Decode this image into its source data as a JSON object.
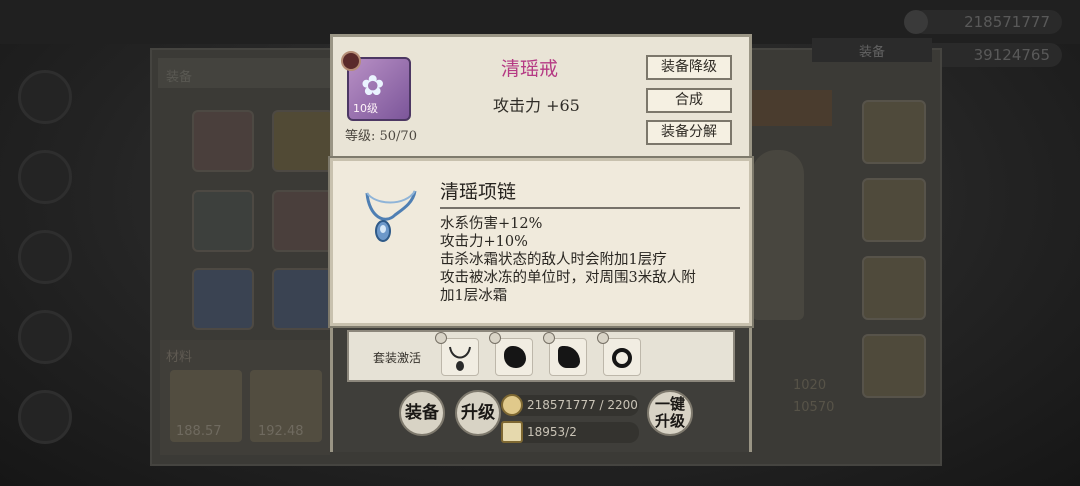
{
  "background": {
    "currencies": [
      "218571777",
      "39124765"
    ],
    "equip_tab": "装备",
    "panel_header": "装备",
    "section_label": "材料",
    "card_values": [
      "188.57",
      "192.48"
    ],
    "stats": [
      "1020",
      "10570"
    ]
  },
  "dialog": {
    "item_name": "清瑶戒",
    "item_level_badge": "10级",
    "stat_line": "攻击力 +65",
    "enhance_level": "等级: 50/70",
    "buttons": {
      "downgrade": "装备降级",
      "synthesize": "合成",
      "decompose": "装备分解",
      "equip": "装备",
      "upgrade": "升级",
      "one_click_upgrade_top": "一键",
      "one_click_upgrade_bottom": "升级"
    },
    "set_label": "套装激活",
    "resources": {
      "coins": "218571777 / 2200",
      "scrolls": "18953/2"
    }
  },
  "tooltip": {
    "title": "清瑶项链",
    "description": [
      "水系伤害+12%",
      "攻击力+10%",
      "击杀冰霜状态的敌人时会附加1层疗",
      "攻击被冰冻的单位时，对周围3米敌人附",
      "加1层冰霜"
    ]
  },
  "colors": {
    "item_name": "#b53a84",
    "dialog_bg": "#e9e4d6",
    "tooltip_bg": "#f0eadc"
  }
}
